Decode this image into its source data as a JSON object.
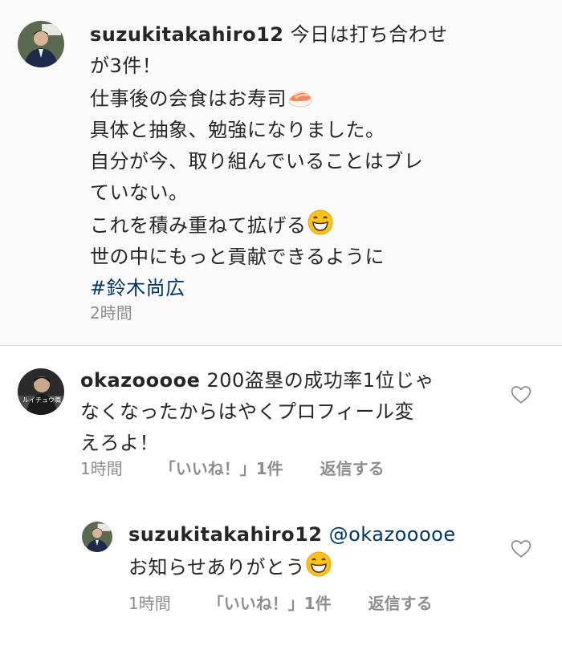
{
  "caption": {
    "username": "suzukitakahiro12",
    "lines": [
      "今日は打ち合わせ",
      "が3件！",
      "仕事後の会食はお寿司",
      "具体と抽象、勉強になりました。",
      "自分が今、取り組んでいることはブレ",
      "ていない。",
      "これを積み重ねて拡げる",
      "世の中にもっと貢献できるように"
    ],
    "hashtag": "#鈴木尚広",
    "time": "2時間",
    "emojis": [
      "sushi-emoji",
      "grinning-emoji"
    ]
  },
  "comments": [
    {
      "username": "okazooooe",
      "lines": [
        "200盗塁の成功率1位じゃ",
        "なくなったからはやくプロフィール変",
        "えろよ！"
      ],
      "time": "1時間",
      "likes": "「いいね！」1件",
      "reply": "返信する",
      "avatar_text": "ルイチュウ職人"
    },
    {
      "username": "suzukitakahiro12",
      "mention": "@okazooooe",
      "lines": [
        "お知らせありがとう"
      ],
      "time": "1時間",
      "likes": "「いいね！」1件",
      "reply": "返信する",
      "emoji": "grinning-emoji"
    }
  ],
  "icons": {
    "like": "heart-outline-icon"
  },
  "colors": {
    "text": "#262626",
    "secondary": "#8e8e8e",
    "link": "#003569",
    "caption_bg": "#fafafa"
  }
}
